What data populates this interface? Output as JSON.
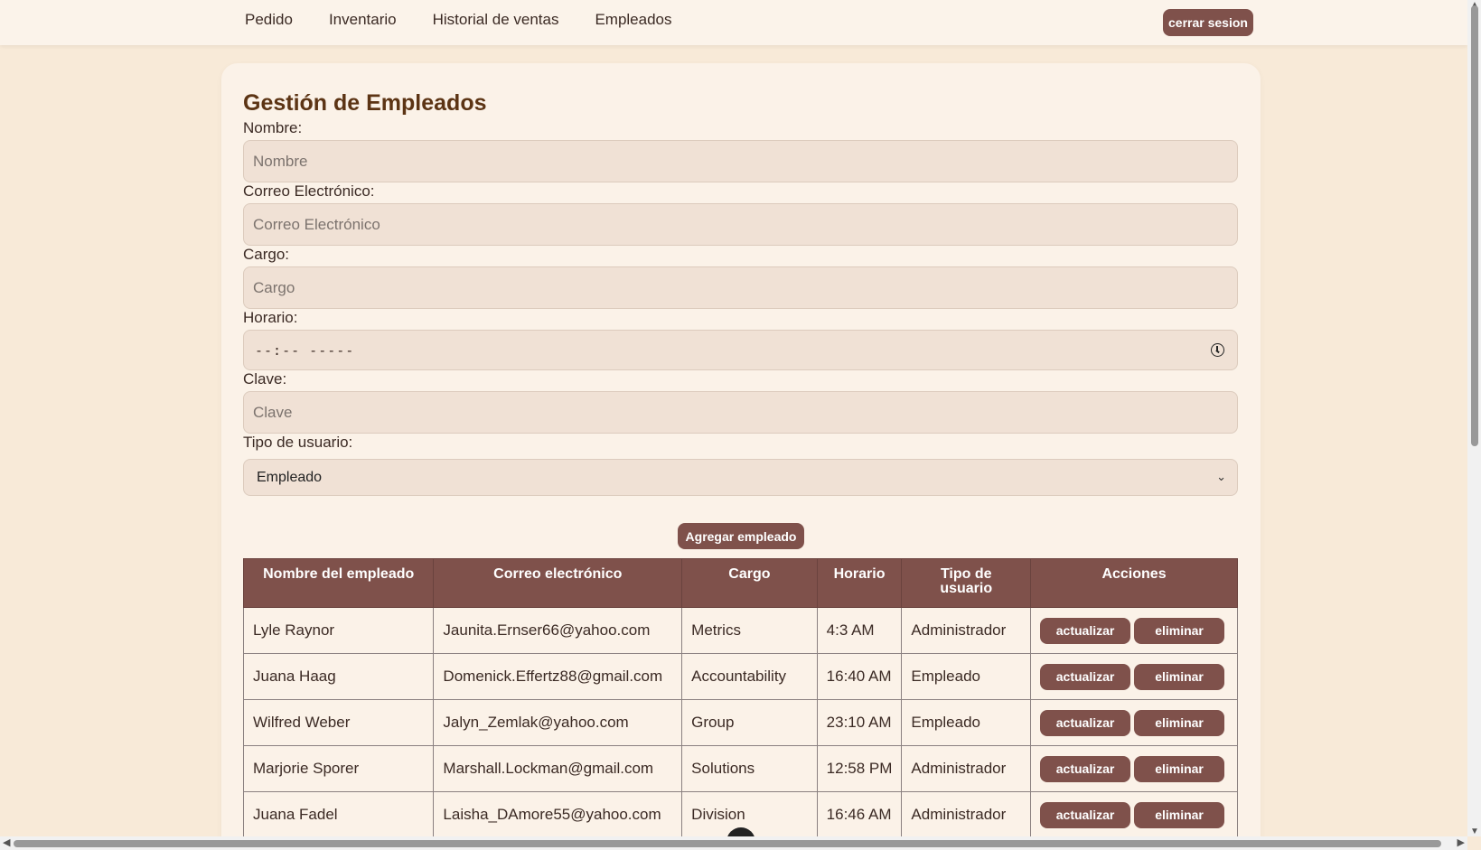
{
  "nav": {
    "items": [
      "Pedido",
      "Inventario",
      "Historial de ventas",
      "Empleados"
    ],
    "logout_label": "cerrar sesion"
  },
  "form": {
    "title": "Gestión de Empleados",
    "nombre_label": "Nombre:",
    "nombre_placeholder": "Nombre",
    "correo_label": "Correo Electrónico:",
    "correo_placeholder": "Correo Electrónico",
    "cargo_label": "Cargo:",
    "cargo_placeholder": "Cargo",
    "horario_label": "Horario:",
    "horario_value": "--:-- -----",
    "clave_label": "Clave:",
    "clave_placeholder": "Clave",
    "tipo_label": "Tipo de usuario:",
    "tipo_selected": "Empleado",
    "add_label": "Agregar empleado"
  },
  "table": {
    "headers": [
      "Nombre del empleado",
      "Correo electrónico",
      "Cargo",
      "Horario",
      "Tipo de usuario",
      "Acciones"
    ],
    "update_label": "actualizar",
    "delete_label": "eliminar",
    "rows": [
      {
        "nombre": "Lyle Raynor",
        "correo": "Jaunita.Ernser66@yahoo.com",
        "cargo": "Metrics",
        "horario": "4:3 AM",
        "tipo": "Administrador"
      },
      {
        "nombre": "Juana Haag",
        "correo": "Domenick.Effertz88@gmail.com",
        "cargo": "Accountability",
        "horario": "16:40 AM",
        "tipo": "Empleado"
      },
      {
        "nombre": "Wilfred Weber",
        "correo": "Jalyn_Zemlak@yahoo.com",
        "cargo": "Group",
        "horario": "23:10 AM",
        "tipo": "Empleado"
      },
      {
        "nombre": "Marjorie Sporer",
        "correo": "Marshall.Lockman@gmail.com",
        "cargo": "Solutions",
        "horario": "12:58 PM",
        "tipo": "Administrador"
      },
      {
        "nombre": "Juana Fadel",
        "correo": "Laisha_DAmore55@yahoo.com",
        "cargo": "Division",
        "horario": "16:46 AM",
        "tipo": "Administrador"
      }
    ]
  },
  "colors": {
    "accent": "#7f514b",
    "background": "#f8ead8",
    "card": "#fbf2e8",
    "input": "#f0e1d5",
    "title": "#5c3414"
  },
  "icons": {
    "clock": "clock-icon",
    "chevron": "chevron-down-icon"
  }
}
